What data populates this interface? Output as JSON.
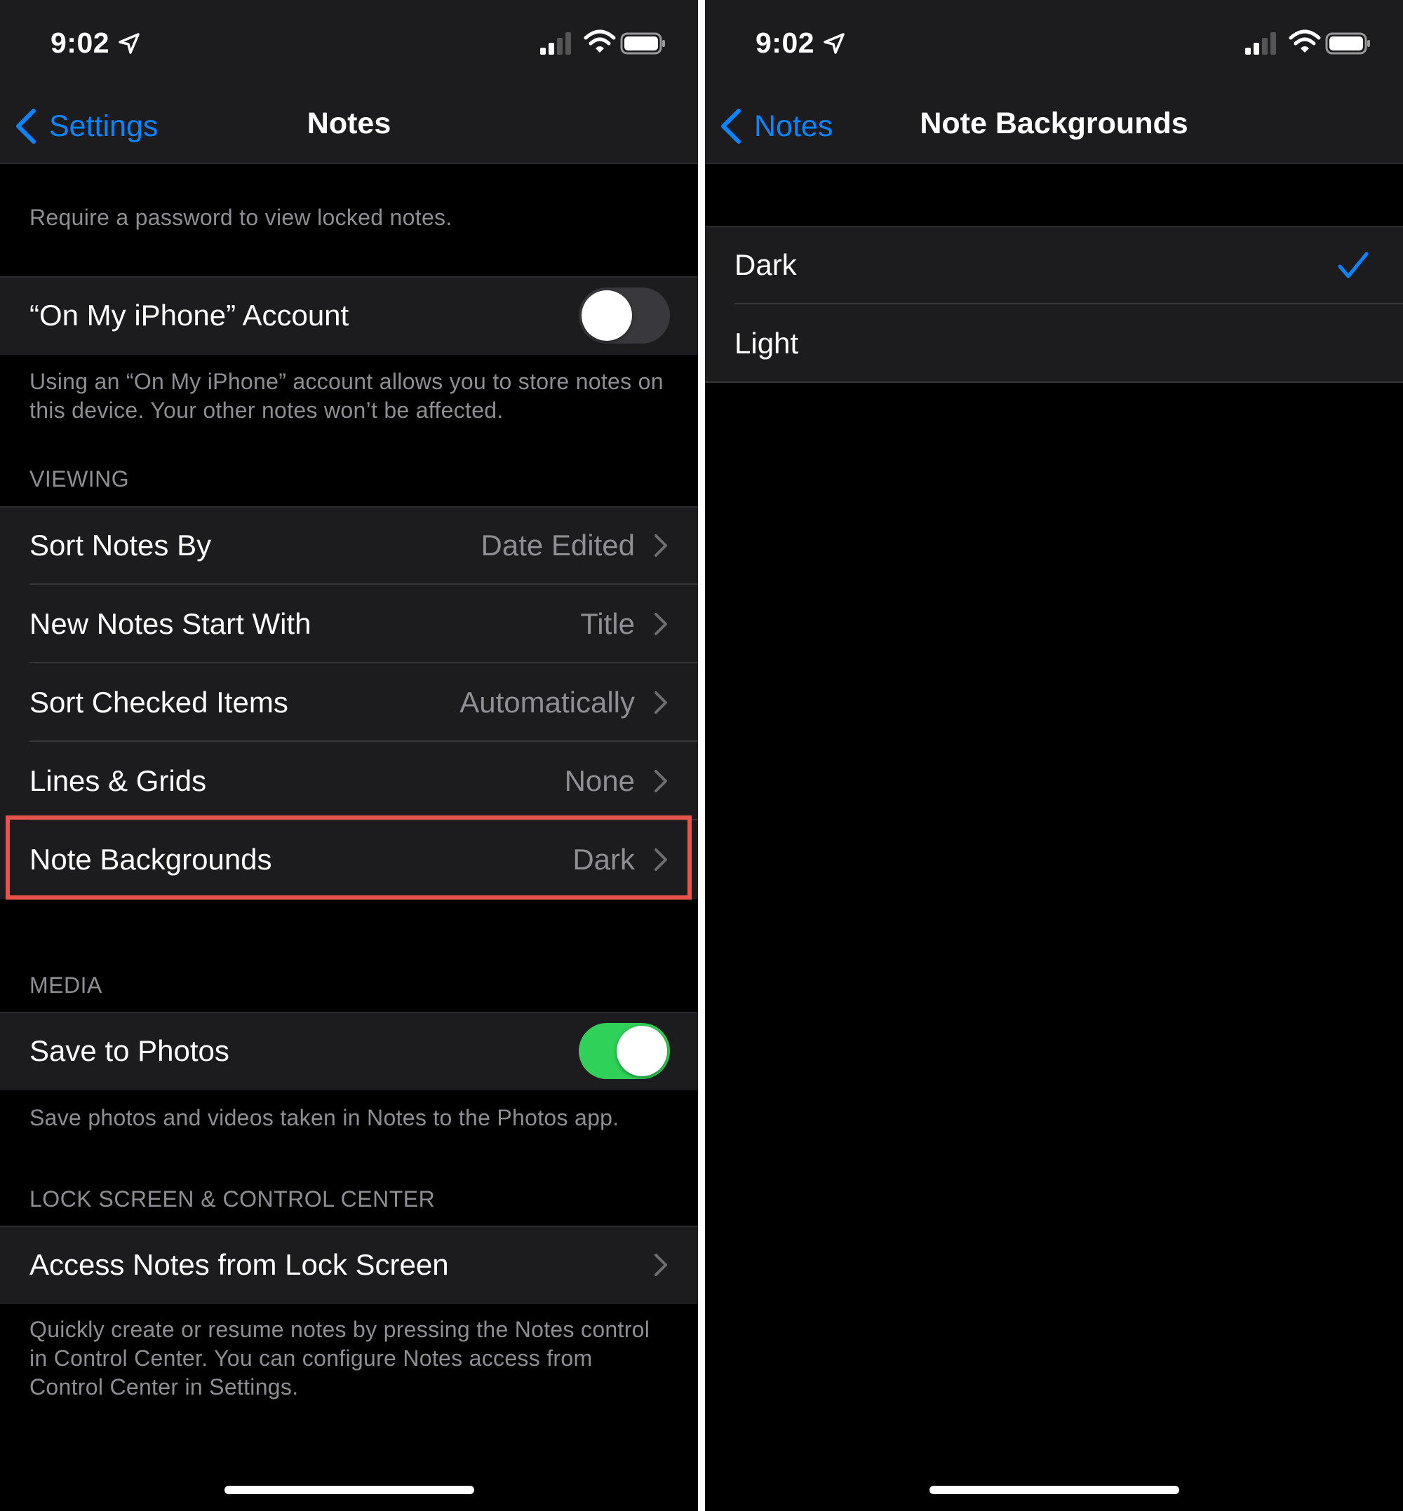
{
  "colors": {
    "accent": "#0a84ff",
    "toggle_on": "#30d158",
    "highlight": "#e8534a"
  },
  "left": {
    "status": {
      "time": "9:02"
    },
    "nav": {
      "back_label": "Settings",
      "title": "Notes"
    },
    "password_footer": "Require a password to view locked notes.",
    "on_my_iphone": {
      "label": "“On My iPhone” Account",
      "toggle": "off",
      "footer": "Using an “On My iPhone” account allows you to store notes on this device. Your other notes won’t be affected."
    },
    "viewing": {
      "header": "VIEWING",
      "rows": [
        {
          "label": "Sort Notes By",
          "value": "Date Edited"
        },
        {
          "label": "New Notes Start With",
          "value": "Title"
        },
        {
          "label": "Sort Checked Items",
          "value": "Automatically"
        },
        {
          "label": "Lines & Grids",
          "value": "None"
        },
        {
          "label": "Note Backgrounds",
          "value": "Dark"
        }
      ]
    },
    "media": {
      "header": "MEDIA",
      "save_to_photos": {
        "label": "Save to Photos",
        "toggle": "on"
      },
      "footer": "Save photos and videos taken in Notes to the Photos app."
    },
    "lock_screen": {
      "header": "LOCK SCREEN & CONTROL CENTER",
      "row_label": "Access Notes from Lock Screen",
      "footer": "Quickly create or resume notes by pressing the Notes control in Control Center. You can configure Notes access from Control Center in Settings."
    }
  },
  "right": {
    "status": {
      "time": "9:02"
    },
    "nav": {
      "back_label": "Notes",
      "title": "Note Backgrounds"
    },
    "options": [
      {
        "label": "Dark",
        "selected": true
      },
      {
        "label": "Light",
        "selected": false
      }
    ]
  }
}
